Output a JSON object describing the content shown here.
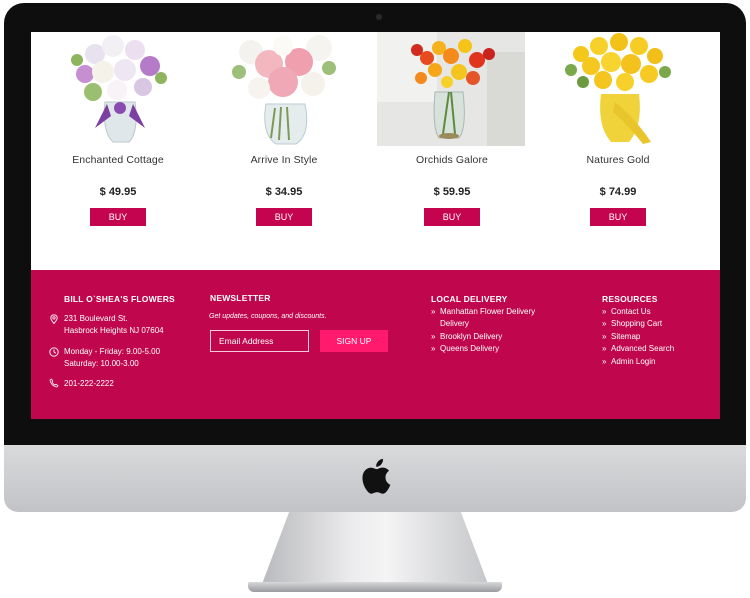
{
  "products": [
    {
      "name": "Enchanted Cottage",
      "price": "$ 49.95",
      "buy_label": "BUY"
    },
    {
      "name": "Arrive In Style",
      "price": "$ 34.95",
      "buy_label": "BUY"
    },
    {
      "name": "Orchids Galore",
      "price": "$ 59.95",
      "buy_label": "BUY"
    },
    {
      "name": "Natures Gold",
      "price": "$ 74.99",
      "buy_label": "BUY"
    }
  ],
  "footer": {
    "store": {
      "title": "BILL O`SHEA'S FLOWERS",
      "address_line1": "231 Boulevard St.",
      "address_line2": "Hasbrock Heights NJ 07604",
      "hours_line1": "Monday - Friday: 9.00-5.00",
      "hours_line2": "Saturday: 10.00-3.00",
      "phone": "201-222-2222"
    },
    "newsletter": {
      "title": "NEWSLETTER",
      "tagline": "Get updates, coupons, and discounts.",
      "email_placeholder": "Email Address",
      "signup_label": "SIGN UP"
    },
    "local_delivery": {
      "title": "LOCAL DELIVERY",
      "links": [
        {
          "line1": "Manhattan Flower Delivery",
          "line2": "Delivery"
        },
        {
          "line1": "Brooklyn Delivery"
        },
        {
          "line1": "Queens Delivery"
        }
      ]
    },
    "resources": {
      "title": "RESOURCES",
      "links": [
        "Contact Us",
        "Shopping Cart",
        "Sitemap",
        "Advanced Search",
        "Admin Login"
      ]
    }
  },
  "colors": {
    "accent": "#c0074d",
    "button": "#c4044f",
    "signup": "#ff1a6e"
  },
  "icons": [
    "location-pin-icon",
    "clock-icon",
    "phone-icon",
    "chevron-right-icon",
    "apple-logo-icon"
  ]
}
